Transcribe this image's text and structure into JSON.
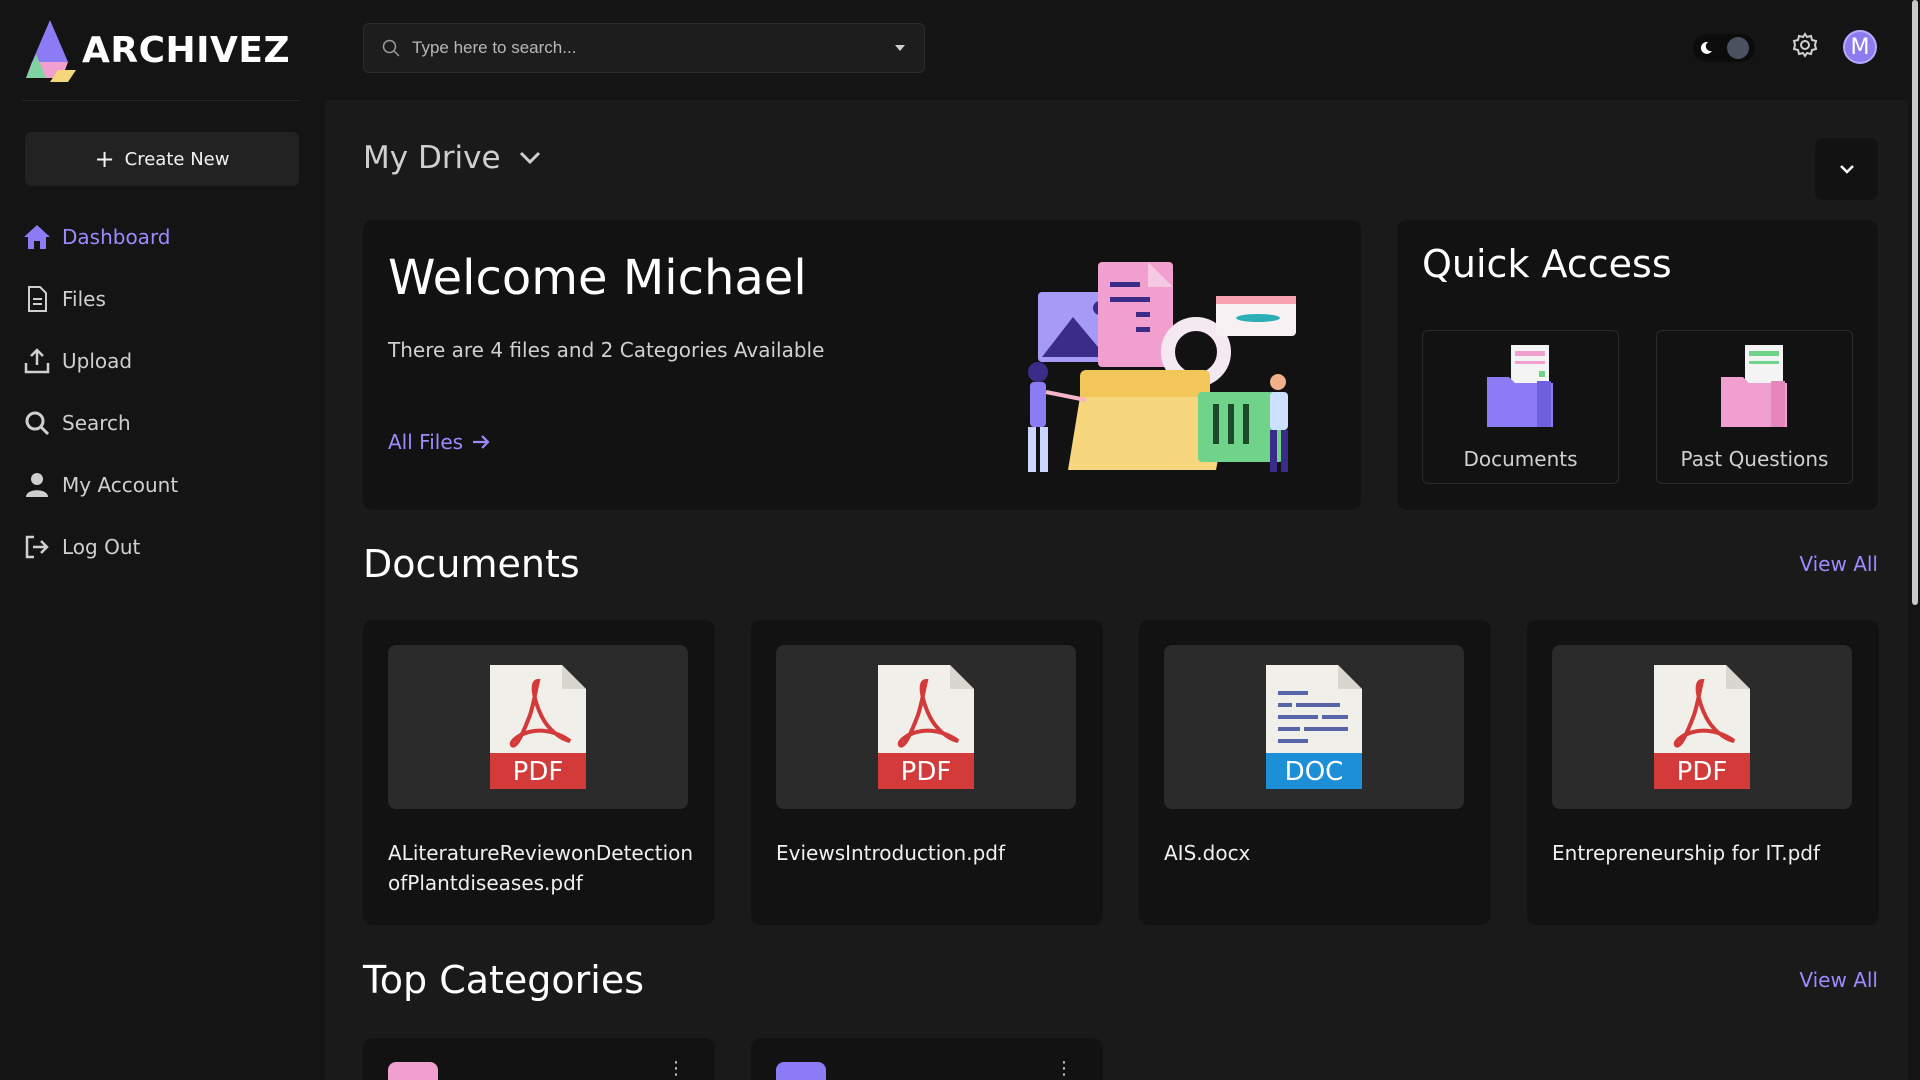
{
  "app": {
    "name": "ARCHIVEZ"
  },
  "sidebar": {
    "create_label": "Create New",
    "items": [
      {
        "label": "Dashboard",
        "icon": "home-icon",
        "active": true
      },
      {
        "label": "Files",
        "icon": "file-icon"
      },
      {
        "label": "Upload",
        "icon": "upload-icon"
      },
      {
        "label": "Search",
        "icon": "search-icon"
      },
      {
        "label": "My Account",
        "icon": "user-icon"
      },
      {
        "label": "Log Out",
        "icon": "logout-icon"
      }
    ]
  },
  "topbar": {
    "search_placeholder": "Type here to search...",
    "avatar_initial": "M"
  },
  "main": {
    "drive_title": "My Drive",
    "welcome": {
      "title": "Welcome Michael",
      "subtitle": "There are 4 files and 2 Categories Available",
      "link": "All Files"
    },
    "quick_access": {
      "title": "Quick Access",
      "tiles": [
        {
          "label": "Documents",
          "color": "#8b7cf6"
        },
        {
          "label": "Past Questions",
          "color": "#f19fcf"
        }
      ]
    },
    "documents": {
      "title": "Documents",
      "view_all": "View All",
      "items": [
        {
          "name": "ALiteratureReviewonDetectionofPlantdiseases.pdf",
          "type": "PDF"
        },
        {
          "name": "EviewsIntroduction.pdf",
          "type": "PDF"
        },
        {
          "name": "AIS.docx",
          "type": "DOC"
        },
        {
          "name": "Entrepreneurship for IT.pdf",
          "type": "PDF"
        }
      ]
    },
    "categories": {
      "title": "Top Categories",
      "view_all": "View All",
      "items": [
        {
          "color": "#f19fcf"
        },
        {
          "color": "#8b7cf6"
        }
      ]
    }
  },
  "colors": {
    "accent": "#9b8bff",
    "pdf": "#d33b3b",
    "doc": "#1c8fd6"
  }
}
